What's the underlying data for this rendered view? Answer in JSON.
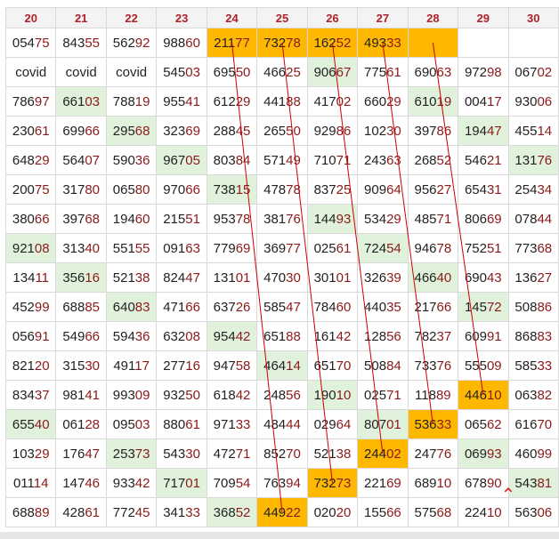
{
  "headers": [
    "20",
    "21",
    "22",
    "23",
    "24",
    "25",
    "26",
    "27",
    "28",
    "29",
    "30"
  ],
  "rows": [
    [
      "05475",
      "84355",
      "56292",
      "98860",
      "21177",
      "73278",
      "16252",
      "49333",
      "",
      "",
      ""
    ],
    [
      "covid",
      "covid",
      "covid",
      "54503",
      "69550",
      "46625",
      "90667",
      "77561",
      "69063",
      "97298",
      "06702"
    ],
    [
      "78697",
      "66103",
      "78819",
      "95541",
      "61229",
      "44188",
      "41702",
      "66029",
      "61019",
      "00417",
      "93006"
    ],
    [
      "23061",
      "69966",
      "29568",
      "32369",
      "28845",
      "26550",
      "92986",
      "10230",
      "39786",
      "19447",
      "45514"
    ],
    [
      "64829",
      "56407",
      "59036",
      "96705",
      "80384",
      "57149",
      "71071",
      "24363",
      "26852",
      "54621",
      "13176"
    ],
    [
      "20075",
      "31780",
      "06580",
      "97066",
      "73815",
      "47878",
      "83725",
      "90964",
      "95627",
      "65431",
      "25434"
    ],
    [
      "38066",
      "39768",
      "19460",
      "21551",
      "95378",
      "38176",
      "14493",
      "53429",
      "48571",
      "80669",
      "07844"
    ],
    [
      "92108",
      "31340",
      "55155",
      "09163",
      "77969",
      "36977",
      "02561",
      "72454",
      "94678",
      "75251",
      "77368"
    ],
    [
      "13411",
      "35616",
      "52138",
      "82447",
      "13101",
      "47030",
      "30101",
      "32639",
      "46640",
      "69043",
      "13627"
    ],
    [
      "45299",
      "68885",
      "64083",
      "47166",
      "63726",
      "58547",
      "78460",
      "44035",
      "21766",
      "14572",
      "50886"
    ],
    [
      "05691",
      "54966",
      "59436",
      "63208",
      "95442",
      "65188",
      "16142",
      "12856",
      "78237",
      "60991",
      "86883"
    ],
    [
      "82120",
      "31530",
      "49117",
      "27716",
      "94758",
      "46414",
      "65170",
      "50884",
      "73376",
      "55509",
      "58533"
    ],
    [
      "83437",
      "98141",
      "99309",
      "93250",
      "61842",
      "24856",
      "19010",
      "02571",
      "11889",
      "44610",
      "06382"
    ],
    [
      "65540",
      "06128",
      "09503",
      "88061",
      "97133",
      "48444",
      "02964",
      "80701",
      "53633",
      "06562",
      "61670"
    ],
    [
      "10329",
      "17647",
      "25373",
      "54330",
      "47271",
      "85270",
      "52138",
      "24402",
      "24776",
      "06993",
      "46099"
    ],
    [
      "01114",
      "14746",
      "93342",
      "71701",
      "70954",
      "76394",
      "73273",
      "22169",
      "68910",
      "67890",
      "54381"
    ],
    [
      "68889",
      "42861",
      "77245",
      "34133",
      "36852",
      "44922",
      "02020",
      "15566",
      "57568",
      "22410",
      "56306"
    ]
  ],
  "green_cells": [
    [
      1,
      6
    ],
    [
      2,
      1
    ],
    [
      2,
      8
    ],
    [
      3,
      2
    ],
    [
      3,
      9
    ],
    [
      4,
      3
    ],
    [
      4,
      10
    ],
    [
      5,
      4
    ],
    [
      6,
      6
    ],
    [
      7,
      0
    ],
    [
      7,
      7
    ],
    [
      8,
      1
    ],
    [
      8,
      8
    ],
    [
      9,
      2
    ],
    [
      9,
      9
    ],
    [
      10,
      4
    ],
    [
      11,
      5
    ],
    [
      12,
      6
    ],
    [
      13,
      0
    ],
    [
      13,
      7
    ],
    [
      14,
      2
    ],
    [
      14,
      9
    ],
    [
      15,
      3
    ],
    [
      15,
      10
    ],
    [
      16,
      4
    ]
  ],
  "orange_cells": [
    [
      0,
      4
    ],
    [
      0,
      5
    ],
    [
      0,
      6
    ],
    [
      0,
      7
    ],
    [
      0,
      8
    ],
    [
      12,
      9
    ],
    [
      13,
      8
    ],
    [
      14,
      7
    ],
    [
      15,
      6
    ],
    [
      16,
      5
    ]
  ],
  "connections": [
    [
      [
        0,
        4
      ],
      [
        16,
        5
      ]
    ],
    [
      [
        0,
        5
      ],
      [
        15,
        6
      ]
    ],
    [
      [
        0,
        6
      ],
      [
        14,
        7
      ]
    ],
    [
      [
        0,
        7
      ],
      [
        13,
        8
      ]
    ],
    [
      [
        0,
        8
      ],
      [
        12,
        9
      ]
    ]
  ],
  "icons": {
    "scroll_up": "chevron-up-icon"
  },
  "colors": {
    "highlight_green": "#e1f2dc",
    "highlight_orange": "#ffb800",
    "header_text": "#b0202a",
    "line": "#cc0000"
  }
}
